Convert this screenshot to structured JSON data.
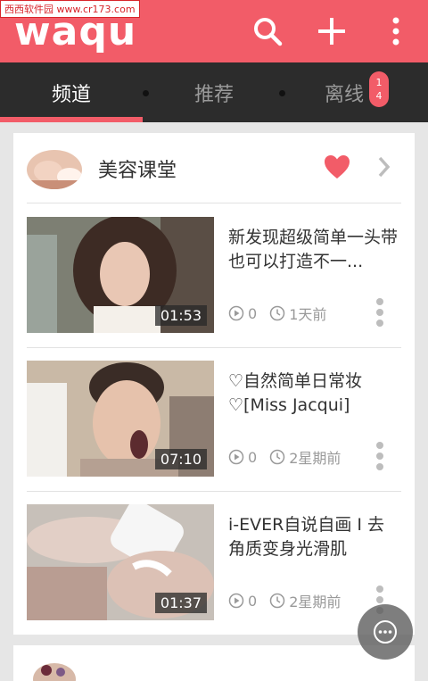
{
  "watermark": "西西软件园 www.cr173.com",
  "appbar": {
    "logo": "waqu",
    "brand_color": "#f25c68"
  },
  "tabs": [
    {
      "label": "频道",
      "active": true
    },
    {
      "label": "推荐",
      "active": false
    },
    {
      "label": "离线",
      "active": false,
      "badge": "14"
    }
  ],
  "channel": {
    "title": "美容课堂",
    "favorited": true
  },
  "videos": [
    {
      "title": "新发现超级简单一头带也可以打造不一...",
      "duration": "01:53",
      "views": "0",
      "time": "1天前"
    },
    {
      "title": "♡自然简单日常妆♡[Miss Jacqui]",
      "duration": "07:10",
      "views": "0",
      "time": "2星期前"
    },
    {
      "title": "i-EVER自说自画 I 去角质变身光滑肌",
      "duration": "01:37",
      "views": "0",
      "time": "2星期前"
    }
  ],
  "icons": [
    "search-icon",
    "plus-icon",
    "overflow-menu-icon",
    "heart-icon",
    "chevron-right-icon",
    "play-count-icon",
    "clock-icon",
    "more-vert-icon",
    "chat-bubble-icon"
  ]
}
